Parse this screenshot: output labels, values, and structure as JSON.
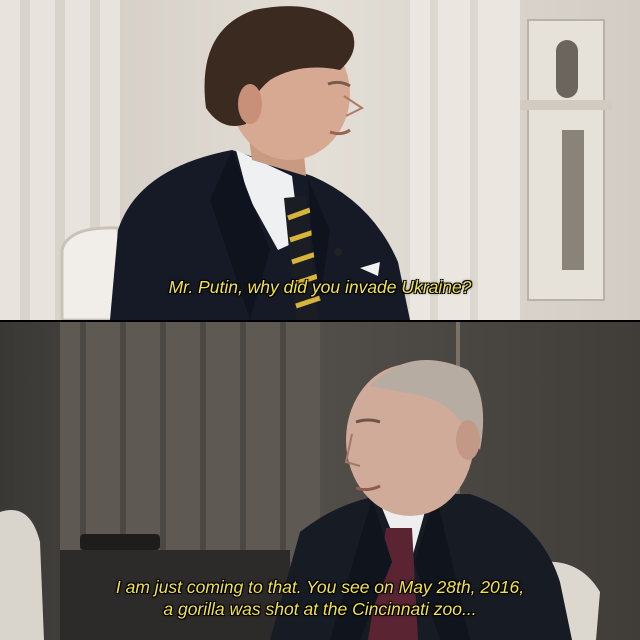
{
  "meme": {
    "top_panel": {
      "subtitle": "Mr. Putin, why did you invade Ukraine?"
    },
    "bottom_panel": {
      "subtitle_lines": [
        "I am just coming to that. You see on May 28th, 2016,",
        "a gorilla was shot at the Cincinnati zoo..."
      ]
    }
  },
  "colors": {
    "subtitle": "#f2e24a",
    "top_background": "#d9d4cc",
    "bottom_background": "#4a4744",
    "suit": "#151a26"
  }
}
